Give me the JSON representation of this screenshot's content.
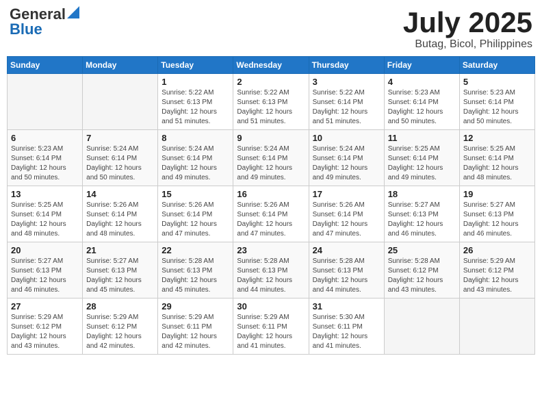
{
  "header": {
    "logo_general": "General",
    "logo_blue": "Blue",
    "title": "July 2025",
    "location": "Butag, Bicol, Philippines"
  },
  "weekdays": [
    "Sunday",
    "Monday",
    "Tuesday",
    "Wednesday",
    "Thursday",
    "Friday",
    "Saturday"
  ],
  "weeks": [
    [
      {
        "day": "",
        "sunrise": "",
        "sunset": "",
        "daylight": ""
      },
      {
        "day": "",
        "sunrise": "",
        "sunset": "",
        "daylight": ""
      },
      {
        "day": "1",
        "sunrise": "Sunrise: 5:22 AM",
        "sunset": "Sunset: 6:13 PM",
        "daylight": "Daylight: 12 hours and 51 minutes."
      },
      {
        "day": "2",
        "sunrise": "Sunrise: 5:22 AM",
        "sunset": "Sunset: 6:13 PM",
        "daylight": "Daylight: 12 hours and 51 minutes."
      },
      {
        "day": "3",
        "sunrise": "Sunrise: 5:22 AM",
        "sunset": "Sunset: 6:14 PM",
        "daylight": "Daylight: 12 hours and 51 minutes."
      },
      {
        "day": "4",
        "sunrise": "Sunrise: 5:23 AM",
        "sunset": "Sunset: 6:14 PM",
        "daylight": "Daylight: 12 hours and 50 minutes."
      },
      {
        "day": "5",
        "sunrise": "Sunrise: 5:23 AM",
        "sunset": "Sunset: 6:14 PM",
        "daylight": "Daylight: 12 hours and 50 minutes."
      }
    ],
    [
      {
        "day": "6",
        "sunrise": "Sunrise: 5:23 AM",
        "sunset": "Sunset: 6:14 PM",
        "daylight": "Daylight: 12 hours and 50 minutes."
      },
      {
        "day": "7",
        "sunrise": "Sunrise: 5:24 AM",
        "sunset": "Sunset: 6:14 PM",
        "daylight": "Daylight: 12 hours and 50 minutes."
      },
      {
        "day": "8",
        "sunrise": "Sunrise: 5:24 AM",
        "sunset": "Sunset: 6:14 PM",
        "daylight": "Daylight: 12 hours and 49 minutes."
      },
      {
        "day": "9",
        "sunrise": "Sunrise: 5:24 AM",
        "sunset": "Sunset: 6:14 PM",
        "daylight": "Daylight: 12 hours and 49 minutes."
      },
      {
        "day": "10",
        "sunrise": "Sunrise: 5:24 AM",
        "sunset": "Sunset: 6:14 PM",
        "daylight": "Daylight: 12 hours and 49 minutes."
      },
      {
        "day": "11",
        "sunrise": "Sunrise: 5:25 AM",
        "sunset": "Sunset: 6:14 PM",
        "daylight": "Daylight: 12 hours and 49 minutes."
      },
      {
        "day": "12",
        "sunrise": "Sunrise: 5:25 AM",
        "sunset": "Sunset: 6:14 PM",
        "daylight": "Daylight: 12 hours and 48 minutes."
      }
    ],
    [
      {
        "day": "13",
        "sunrise": "Sunrise: 5:25 AM",
        "sunset": "Sunset: 6:14 PM",
        "daylight": "Daylight: 12 hours and 48 minutes."
      },
      {
        "day": "14",
        "sunrise": "Sunrise: 5:26 AM",
        "sunset": "Sunset: 6:14 PM",
        "daylight": "Daylight: 12 hours and 48 minutes."
      },
      {
        "day": "15",
        "sunrise": "Sunrise: 5:26 AM",
        "sunset": "Sunset: 6:14 PM",
        "daylight": "Daylight: 12 hours and 47 minutes."
      },
      {
        "day": "16",
        "sunrise": "Sunrise: 5:26 AM",
        "sunset": "Sunset: 6:14 PM",
        "daylight": "Daylight: 12 hours and 47 minutes."
      },
      {
        "day": "17",
        "sunrise": "Sunrise: 5:26 AM",
        "sunset": "Sunset: 6:14 PM",
        "daylight": "Daylight: 12 hours and 47 minutes."
      },
      {
        "day": "18",
        "sunrise": "Sunrise: 5:27 AM",
        "sunset": "Sunset: 6:13 PM",
        "daylight": "Daylight: 12 hours and 46 minutes."
      },
      {
        "day": "19",
        "sunrise": "Sunrise: 5:27 AM",
        "sunset": "Sunset: 6:13 PM",
        "daylight": "Daylight: 12 hours and 46 minutes."
      }
    ],
    [
      {
        "day": "20",
        "sunrise": "Sunrise: 5:27 AM",
        "sunset": "Sunset: 6:13 PM",
        "daylight": "Daylight: 12 hours and 46 minutes."
      },
      {
        "day": "21",
        "sunrise": "Sunrise: 5:27 AM",
        "sunset": "Sunset: 6:13 PM",
        "daylight": "Daylight: 12 hours and 45 minutes."
      },
      {
        "day": "22",
        "sunrise": "Sunrise: 5:28 AM",
        "sunset": "Sunset: 6:13 PM",
        "daylight": "Daylight: 12 hours and 45 minutes."
      },
      {
        "day": "23",
        "sunrise": "Sunrise: 5:28 AM",
        "sunset": "Sunset: 6:13 PM",
        "daylight": "Daylight: 12 hours and 44 minutes."
      },
      {
        "day": "24",
        "sunrise": "Sunrise: 5:28 AM",
        "sunset": "Sunset: 6:13 PM",
        "daylight": "Daylight: 12 hours and 44 minutes."
      },
      {
        "day": "25",
        "sunrise": "Sunrise: 5:28 AM",
        "sunset": "Sunset: 6:12 PM",
        "daylight": "Daylight: 12 hours and 43 minutes."
      },
      {
        "day": "26",
        "sunrise": "Sunrise: 5:29 AM",
        "sunset": "Sunset: 6:12 PM",
        "daylight": "Daylight: 12 hours and 43 minutes."
      }
    ],
    [
      {
        "day": "27",
        "sunrise": "Sunrise: 5:29 AM",
        "sunset": "Sunset: 6:12 PM",
        "daylight": "Daylight: 12 hours and 43 minutes."
      },
      {
        "day": "28",
        "sunrise": "Sunrise: 5:29 AM",
        "sunset": "Sunset: 6:12 PM",
        "daylight": "Daylight: 12 hours and 42 minutes."
      },
      {
        "day": "29",
        "sunrise": "Sunrise: 5:29 AM",
        "sunset": "Sunset: 6:11 PM",
        "daylight": "Daylight: 12 hours and 42 minutes."
      },
      {
        "day": "30",
        "sunrise": "Sunrise: 5:29 AM",
        "sunset": "Sunset: 6:11 PM",
        "daylight": "Daylight: 12 hours and 41 minutes."
      },
      {
        "day": "31",
        "sunrise": "Sunrise: 5:30 AM",
        "sunset": "Sunset: 6:11 PM",
        "daylight": "Daylight: 12 hours and 41 minutes."
      },
      {
        "day": "",
        "sunrise": "",
        "sunset": "",
        "daylight": ""
      },
      {
        "day": "",
        "sunrise": "",
        "sunset": "",
        "daylight": ""
      }
    ]
  ]
}
